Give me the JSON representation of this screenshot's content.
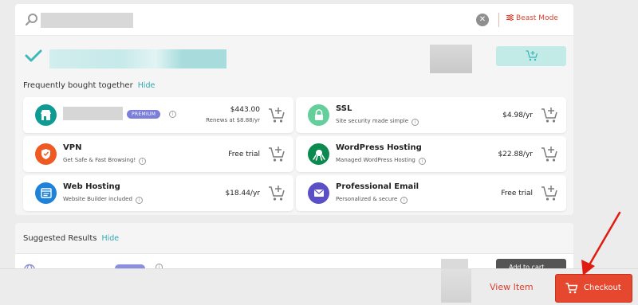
{
  "search": {
    "beast_mode_label": "Beast Mode",
    "clear_symbol": "✕"
  },
  "icons": {
    "search": "search-icon",
    "clear": "close-icon",
    "beast_mode": "sliders-icon",
    "checkmark": "checkmark-icon",
    "add_to_cart": "cart-plus-icon",
    "checkout": "cart-icon"
  },
  "frequently_bought": {
    "title": "Frequently bought together",
    "hide_label": "Hide",
    "products": [
      {
        "name": "",
        "badge": "PREMIUM",
        "price": "$443.00",
        "renewal": "Renews at $8.88/yr",
        "icon": "domain-store-icon",
        "color": "#0e9b94"
      },
      {
        "name": "SSL",
        "description": "Site security made simple",
        "price": "$4.98/yr",
        "icon": "lock-icon",
        "color": "#63cf9a"
      },
      {
        "name": "VPN",
        "description": "Get Safe & Fast Browsing!",
        "price": "Free trial",
        "icon": "vpn-shield-icon",
        "color": "#ee5a22"
      },
      {
        "name": "WordPress Hosting",
        "description": "Managed WordPress Hosting",
        "price": "$22.88/yr",
        "icon": "octopus-icon",
        "color": "#0b8a4f"
      },
      {
        "name": "Web Hosting",
        "description": "Website Builder included",
        "price": "$18.44/yr",
        "icon": "hosting-window-icon",
        "color": "#1e82d8"
      },
      {
        "name": "Professional Email",
        "description": "Personalized & secure",
        "price": "Free trial",
        "icon": "envelope-icon",
        "color": "#5b4fc5"
      }
    ]
  },
  "suggested": {
    "title": "Suggested Results",
    "hide_label": "Hide",
    "first_result_name": "...............",
    "add_label": "Add to cart"
  },
  "footer": {
    "view_item_label": "View Item",
    "checkout_label": "Checkout"
  },
  "colors": {
    "accent": "#d9412f",
    "checkout": "#e5482f",
    "teal": "#31a8b0",
    "premium_badge": "#7b7fd9"
  }
}
